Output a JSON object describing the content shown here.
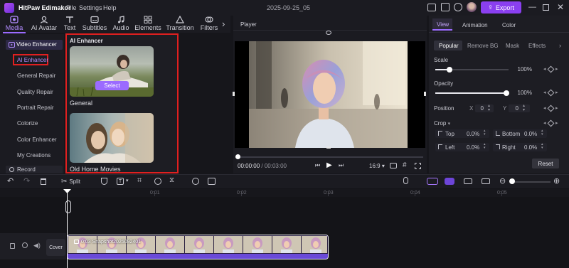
{
  "titlebar": {
    "app_name": "HitPaw Edimakor",
    "menus": [
      "File",
      "Settings",
      "Help"
    ],
    "project_title": "2025-09-25_05",
    "export_label": "Export"
  },
  "toolbar": {
    "tabs": [
      {
        "label": "Media",
        "icon": "media-icon"
      },
      {
        "label": "AI Avatar",
        "icon": "ai-avatar-icon"
      },
      {
        "label": "Text",
        "icon": "text-icon"
      },
      {
        "label": "Subtitles",
        "icon": "subtitles-icon"
      },
      {
        "label": "Audio",
        "icon": "audio-icon"
      },
      {
        "label": "Elements",
        "icon": "elements-icon"
      },
      {
        "label": "Transition",
        "icon": "transition-icon"
      },
      {
        "label": "Filters",
        "icon": "filters-icon"
      }
    ]
  },
  "sidebar": {
    "section": "Video Enhancer",
    "items": [
      "AI Enhancer",
      "General Repair",
      "Quality Repair",
      "Portrait Repair",
      "Colorize",
      "Color Enhancer",
      "My Creations"
    ],
    "record": "Record"
  },
  "media_panel": {
    "title": "AI Enhancer",
    "cards": [
      {
        "label": "General",
        "button": "Select"
      },
      {
        "label": "Old Home Movies"
      }
    ]
  },
  "player": {
    "title": "Player",
    "time_current": "00:00:00",
    "time_sep": "/",
    "time_total": "00:03:00",
    "aspect": "16:9"
  },
  "props": {
    "tabs": [
      "View",
      "Animation",
      "Color"
    ],
    "subtabs": [
      "Popular",
      "Remove BG",
      "Mask",
      "Effects"
    ],
    "scale_label": "Scale",
    "scale_value": "100%",
    "opacity_label": "Opacity",
    "opacity_value": "100%",
    "position_label": "Position",
    "pos_x_label": "X",
    "pos_x": "0",
    "pos_y_label": "Y",
    "pos_y": "0",
    "crop_label": "Crop",
    "crop_top_label": "Top",
    "crop_top": "0.0%",
    "crop_bottom_label": "Bottom",
    "crop_bottom": "0.0%",
    "crop_left_label": "Left",
    "crop_left": "0.0%",
    "crop_right_label": "Right",
    "crop_right": "0.0%",
    "reset_label": "Reset",
    "scale_level": 1.0,
    "opacity_level": 1.0
  },
  "timeline": {
    "split_label": "Split",
    "ticks": [
      "0:01",
      "0:02",
      "0:03",
      "0:04",
      "0:05"
    ],
    "cover_label": "Cover",
    "clip_label": "0:03 Snapshot2025092401"
  },
  "colors": {
    "accent": "#8a3ff0",
    "highlight_border": "#e02020",
    "clip_base": "#5a36c8"
  }
}
